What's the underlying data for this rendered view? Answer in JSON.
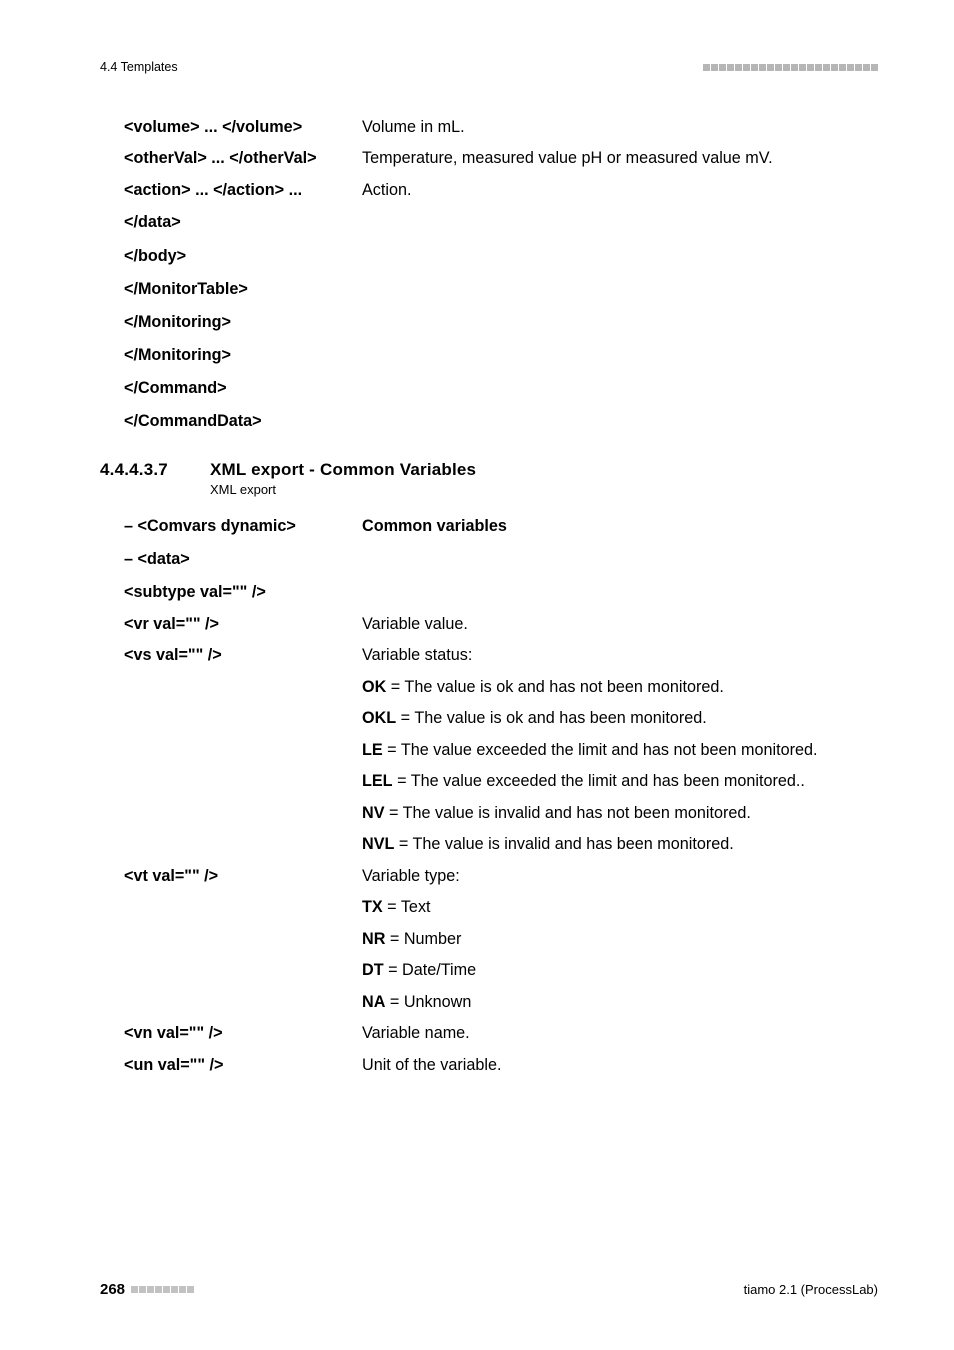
{
  "header": {
    "breadcrumb": "4.4 Templates"
  },
  "section1": {
    "rows": [
      {
        "left": "<volume> ... </volume>",
        "right": "Volume in mL."
      },
      {
        "left": "<otherVal> ... </otherVal>",
        "right": "Temperature, measured value pH or measured value mV."
      },
      {
        "left": "<action> ... </action> ...",
        "right": "Action."
      }
    ],
    "closers": [
      "</data>",
      "</body>",
      "</MonitorTable>",
      "</Monitoring>",
      "</Monitoring>",
      "</Command>",
      "</CommandData>"
    ]
  },
  "heading": {
    "number": "4.4.4.3.7",
    "title": "XML export - Common Variables",
    "sub": "XML export"
  },
  "section2": {
    "r1": {
      "left": "– <Comvars dynamic>",
      "right": "Common variables"
    },
    "r2": {
      "left": "– <data>"
    },
    "r3": {
      "left": "<subtype val=\"\" />"
    },
    "r4": {
      "left": "<vr val=\"\" />",
      "right": "Variable value."
    },
    "r5": {
      "left": "<vs val=\"\" />",
      "right": "Variable status:"
    },
    "status": {
      "ok": {
        "b": "OK",
        "t": " = The value is ok and has not been monitored."
      },
      "okl": {
        "b": "OKL",
        "t": " = The value is ok and has been monitored."
      },
      "le": {
        "b": "LE",
        "t": " = The value exceeded the limit and has not been monitored."
      },
      "lel": {
        "b": "LEL",
        "t": " = The value exceeded the limit and has been monitored.."
      },
      "nv": {
        "b": "NV",
        "t": " = The value is invalid and has not been monitored."
      },
      "nvl": {
        "b": "NVL",
        "t": " = The value is invalid and has been monitored."
      }
    },
    "r6": {
      "left": "<vt val=\"\" />",
      "right": "Variable type:"
    },
    "types": {
      "tx": {
        "b": "TX",
        "t": " = Text"
      },
      "nr": {
        "b": "NR",
        "t": " = Number"
      },
      "dt": {
        "b": "DT",
        "t": " = Date/Time"
      },
      "na": {
        "b": "NA",
        "t": " = Unknown"
      }
    },
    "r7": {
      "left": "<vn val=\"\" />",
      "right": "Variable name."
    },
    "r8": {
      "left": "<un val=\"\" />",
      "right": "Unit of the variable."
    }
  },
  "footer": {
    "page": "268",
    "product": "tiamo 2.1 (ProcessLab)"
  }
}
